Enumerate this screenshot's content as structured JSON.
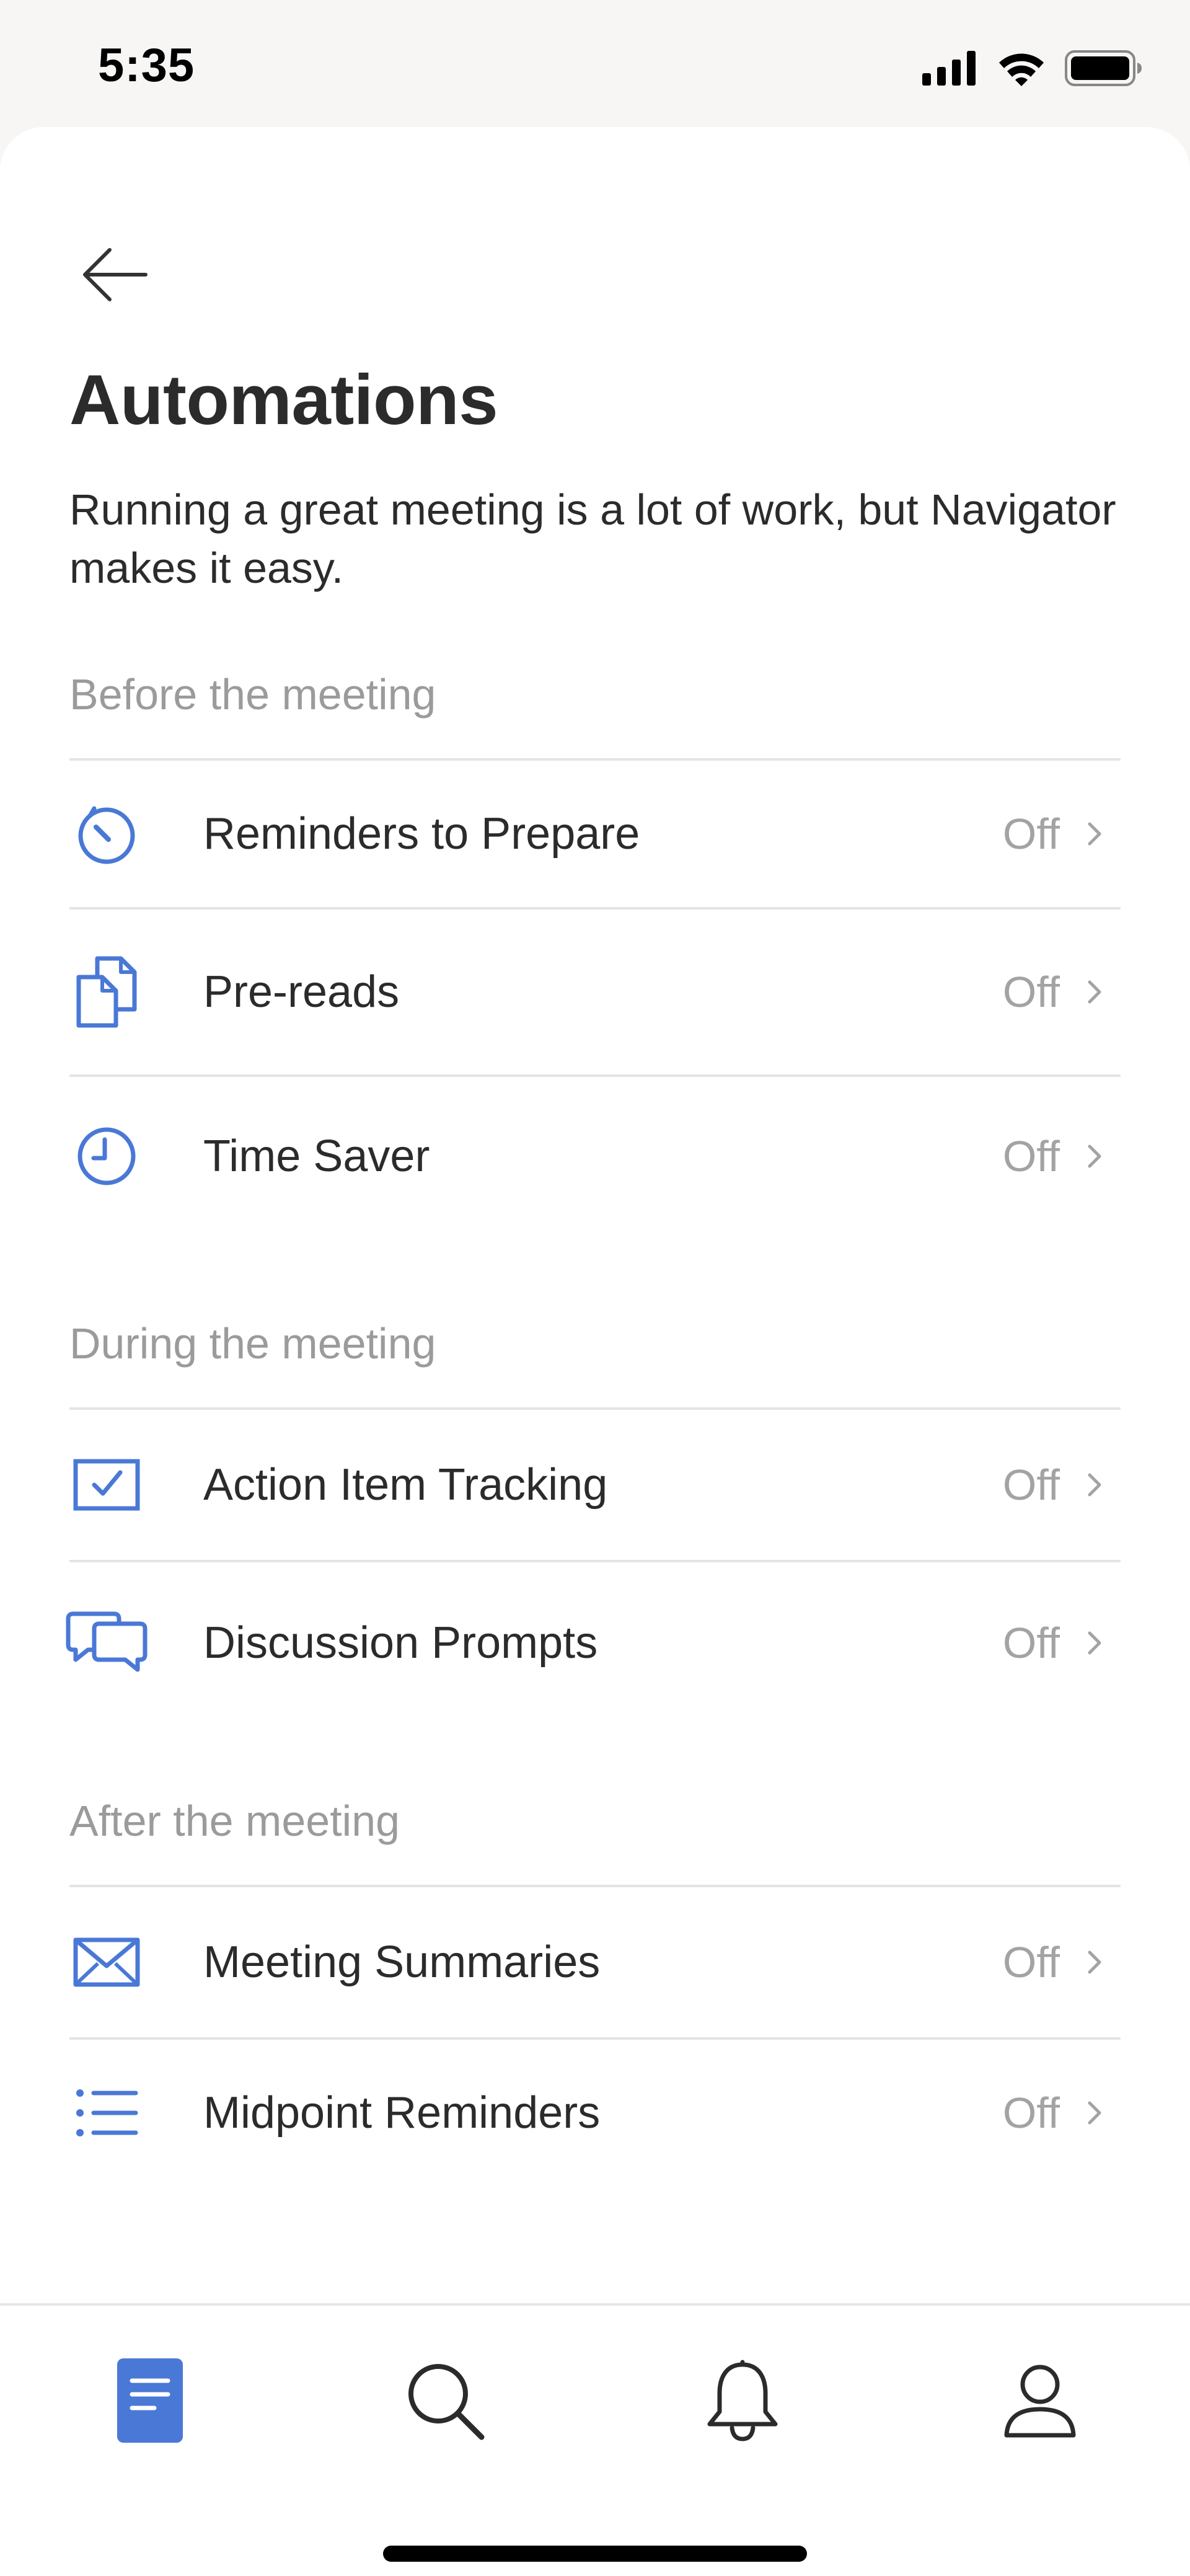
{
  "status_bar": {
    "time": "5:35",
    "icons": [
      "cellular-signal-icon",
      "wifi-icon",
      "battery-icon"
    ]
  },
  "header": {
    "back_icon": "arrow-left-icon",
    "title": "Automations",
    "description": "Running a great meeting is a lot of work, but Navigator makes it easy."
  },
  "sections": [
    {
      "heading": "Before the meeting",
      "items": [
        {
          "label": "Reminders to Prepare",
          "value": "Off",
          "icon": "timer-icon"
        },
        {
          "label": "Pre-reads",
          "value": "Off",
          "icon": "documents-icon"
        },
        {
          "label": "Time Saver",
          "value": "Off",
          "icon": "clock-icon"
        }
      ]
    },
    {
      "heading": "During the meeting",
      "items": [
        {
          "label": "Action Item Tracking",
          "value": "Off",
          "icon": "checkbox-icon"
        },
        {
          "label": "Discussion Prompts",
          "value": "Off",
          "icon": "chat-bubbles-icon"
        }
      ]
    },
    {
      "heading": "After the meeting",
      "items": [
        {
          "label": "Meeting Summaries",
          "value": "Off",
          "icon": "envelope-icon"
        },
        {
          "label": "Midpoint Reminders",
          "value": "Off",
          "icon": "list-icon"
        }
      ]
    }
  ],
  "tab_bar": {
    "tabs": [
      {
        "icon": "document-icon",
        "active": true
      },
      {
        "icon": "search-icon",
        "active": false
      },
      {
        "icon": "bell-icon",
        "active": false
      },
      {
        "icon": "person-icon",
        "active": false
      }
    ]
  },
  "colors": {
    "accent": "#4a78d6",
    "text": "#2b2b2b",
    "muted": "#9b9b9b",
    "divider": "#e4e4e4"
  }
}
